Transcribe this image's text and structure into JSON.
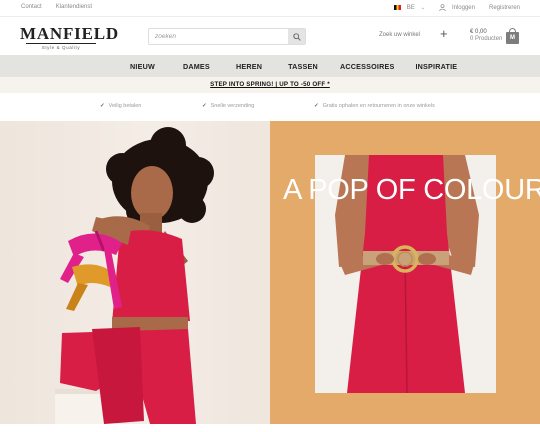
{
  "topbar": {
    "links": [
      "Contact",
      "Klantendienst"
    ],
    "country": "BE",
    "login": "Inloggen",
    "register": "Registreren"
  },
  "header": {
    "logo_text": "MANFIELD",
    "logo_tagline": "Style & Quality",
    "search_placeholder": "zoeken",
    "store_finder": "Zoek uw winkel",
    "store_plus": "+",
    "cart_total": "€ 0,00",
    "cart_count": "0 Producten",
    "cart_badge": "M"
  },
  "nav": {
    "items": [
      "NIEUW",
      "DAMES",
      "HEREN",
      "TASSEN",
      "ACCESSOIRES",
      "INSPIRATIE"
    ]
  },
  "promo": {
    "text": "STEP INTO SPRING! | UP TO -50 OFF *"
  },
  "usps": [
    "Veilig betalen",
    "Snelle verzending",
    "Gratis ophalen en retourneren in onze winkels"
  ],
  "hero": {
    "headline": "A POP OF COLOUR!"
  },
  "colors": {
    "nav_bg": "#e3e3e0",
    "promo_bg": "#f6f3ec",
    "hero_right_bg": "#e4aa6a",
    "accent_red": "#d81e45",
    "accent_pink": "#e0218a"
  }
}
